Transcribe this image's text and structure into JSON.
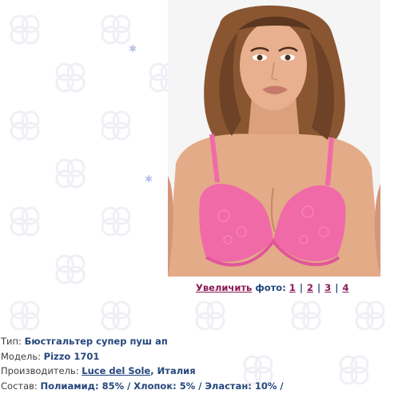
{
  "photo": {
    "image_label": "product-photo"
  },
  "photo_nav": {
    "enlarge_label": "Увеличить",
    "photo_label": " фото: ",
    "separator": "|",
    "pages": [
      "1",
      "2",
      "3",
      "4"
    ]
  },
  "specs": {
    "type_label": "Тип: ",
    "type_value": "Бюстгальтер супер пуш ап",
    "model_label": "Модель: ",
    "model_value": "Pizzo 1701",
    "maker_label": "Производитель: ",
    "maker_link": "Luce del Sole",
    "maker_country": ", Италия",
    "composition_label": "Состав: ",
    "composition_value": "Полиамид: 85% / Хлопок: 5% / Эластан: 10% /"
  },
  "colors": {
    "link_maroon": "#8a1a55",
    "value_blue": "#26467c",
    "bra_pink": "#f06aa8"
  }
}
